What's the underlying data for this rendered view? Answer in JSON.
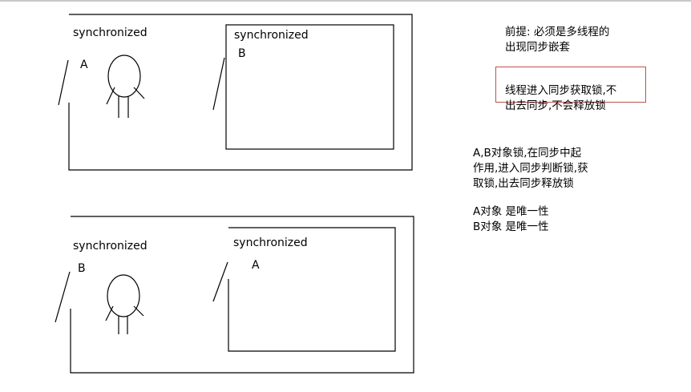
{
  "top_diagram": {
    "outer_label": "synchronized",
    "outer_lock": "A",
    "inner_label": "synchronized",
    "inner_lock": "B"
  },
  "bottom_diagram": {
    "outer_label": "synchronized",
    "outer_lock": "B",
    "inner_label": "synchronized",
    "inner_lock": "A"
  },
  "notes": {
    "premise": "前提: 必须是多线程的\n出现同步嵌套",
    "boxed": "线程进入同步获取锁,不\n出去同步,不会释放锁",
    "lock_role": "A,B对象锁,在同步中起\n作用,进入同步判断锁,获\n取锁,出去同步释放锁",
    "uniqueness": "A对象  是唯一性\nB对象  是唯一性"
  },
  "colors": {
    "box_border": "#c0504d",
    "stroke": "#000000"
  },
  "icons": [
    "person-icon",
    "door-icon"
  ]
}
